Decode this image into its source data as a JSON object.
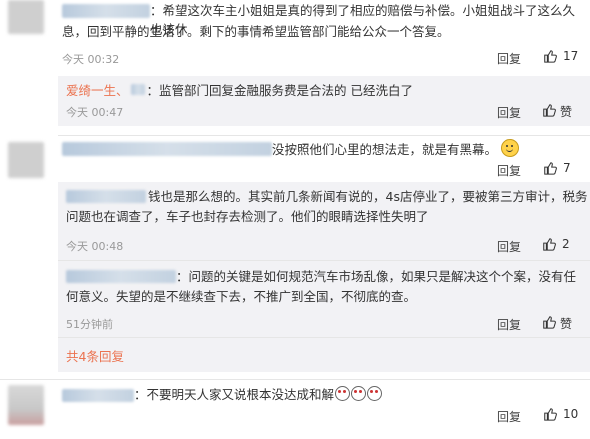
{
  "comments": [
    {
      "text": "：希望这次车主小姐姐是真的得到了相应的赔偿与补偿。小姐姐战斗了这么久也该休息，回到平静的生活了。剩下的事情希望监管部门能给公众一个答复。",
      "line1": "：希望这次车主小姐姐是真的得到了相应的赔偿与补偿。小姐姐战斗了这么久也该休",
      "line2": "息，回到平静的生活了。剩下的事情希望监管部门能给公众一个答复。",
      "time": "今天 00:32",
      "reply_label": "回复",
      "like_count": "17"
    },
    {
      "text": "没按照他们心里的想法走，就是有黑幕。",
      "time": "",
      "reply_label": "回复",
      "like_count": "7"
    },
    {
      "text": "：不要明天人家又说根本没达成和解",
      "time": "",
      "reply_label": "回复",
      "like_count": "10"
    }
  ],
  "sub_replies": [
    {
      "author": "爱绮一生、",
      "text": "：监管部门回复金融服务费是合法的 已经洗白了",
      "time": "今天 00:47",
      "reply_label": "回复",
      "like_label": "赞"
    },
    {
      "line1": "钱也是那么想的。其实前几条新闻有说的，4s店停业了，要被第三方审计，税务",
      "line2": "问题也在调查了，车子也封存去检测了。他们的眼睛选择性失明了",
      "time": "今天 00:48",
      "reply_label": "回复",
      "like_count": "2"
    },
    {
      "line1": "：问题的关键是如何规范汽车市场乱像，如果只是解决这个个案，没有任",
      "line2": "何意义。失望的是不继续查下去，不推广到全国，不彻底的查。",
      "time": "51分钟前",
      "reply_label": "回复",
      "like_label": "赞"
    }
  ],
  "more_replies": "共4条回复",
  "colors": {
    "link": "#eb7350",
    "reply_bg": "#f2f2f5",
    "time": "#999999"
  }
}
